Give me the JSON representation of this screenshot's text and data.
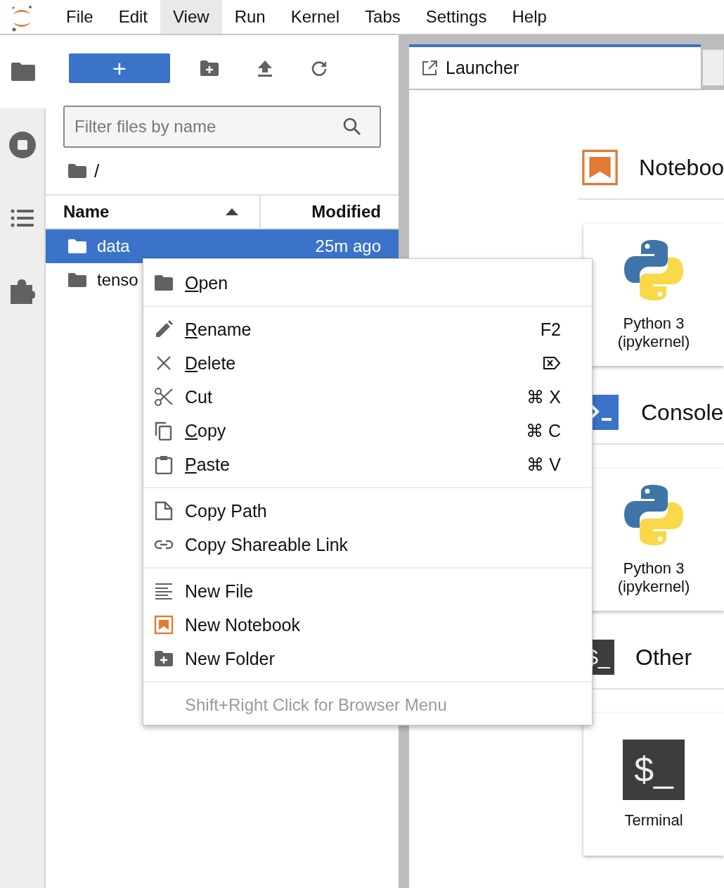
{
  "menubar": {
    "menus": [
      {
        "label": "File",
        "selected": false
      },
      {
        "label": "Edit",
        "selected": false
      },
      {
        "label": "View",
        "selected": true
      },
      {
        "label": "Run",
        "selected": false
      },
      {
        "label": "Kernel",
        "selected": false
      },
      {
        "label": "Tabs",
        "selected": false
      },
      {
        "label": "Settings",
        "selected": false
      },
      {
        "label": "Help",
        "selected": false
      }
    ]
  },
  "activity_bar": {
    "tabs": [
      {
        "kind": "files",
        "selected": true
      },
      {
        "kind": "running",
        "selected": false
      },
      {
        "kind": "toc",
        "selected": false
      },
      {
        "kind": "extensions",
        "selected": false
      }
    ]
  },
  "file_browser": {
    "new_button": "+",
    "filter": {
      "placeholder": "Filter files by name"
    },
    "breadcrumb": "/",
    "columns": [
      {
        "label": "Name",
        "sorted": true
      },
      {
        "label": "Modified",
        "sorted": false
      }
    ],
    "rows": [
      {
        "name": "data",
        "modified": "25m ago",
        "selected": true
      },
      {
        "name": "tenso",
        "selected": false
      }
    ]
  },
  "tabs": [
    {
      "label": "Launcher",
      "selected": true
    }
  ],
  "launcher": {
    "sections": [
      {
        "title": "Noteboo",
        "kind": "notebook",
        "cards": [
          {
            "label": "Python 3 (ipykernel)",
            "kind": "python"
          }
        ]
      },
      {
        "title": "Console",
        "kind": "console",
        "cards": [
          {
            "label": "Python 3 (ipykernel)",
            "kind": "python"
          }
        ]
      },
      {
        "title": "Other",
        "kind": "terminal",
        "icon_text": "$_",
        "cards": [
          {
            "label": "Terminal",
            "kind": "terminal",
            "icon_text": "$_"
          }
        ]
      }
    ]
  },
  "context_menu": {
    "groups": [
      [
        {
          "label": "Open",
          "mnemonic": true
        }
      ],
      [
        {
          "label": "Rename",
          "mnemonic": true,
          "shortcut": {
            "kind": "text",
            "text": "F2"
          }
        },
        {
          "label": "Delete",
          "mnemonic": true,
          "shortcut": {
            "kind": "delete-key"
          }
        },
        {
          "label": "Cut",
          "mnemonic": false,
          "shortcut": {
            "kind": "text",
            "text": "⌘ X"
          }
        },
        {
          "label": "Copy",
          "mnemonic": true,
          "shortcut": {
            "kind": "text",
            "text": "⌘ C"
          }
        },
        {
          "label": "Paste",
          "mnemonic": true,
          "shortcut": {
            "kind": "text",
            "text": "⌘ V"
          }
        }
      ],
      [
        {
          "label": "Copy Path",
          "mnemonic": false
        },
        {
          "label": "Copy Shareable Link",
          "mnemonic": false
        }
      ],
      [
        {
          "label": "New File",
          "mnemonic": false
        },
        {
          "label": "New Notebook",
          "mnemonic": false
        },
        {
          "label": "New Folder",
          "mnemonic": false
        }
      ]
    ],
    "hint": "Shift+Right Click for Browser Menu"
  }
}
